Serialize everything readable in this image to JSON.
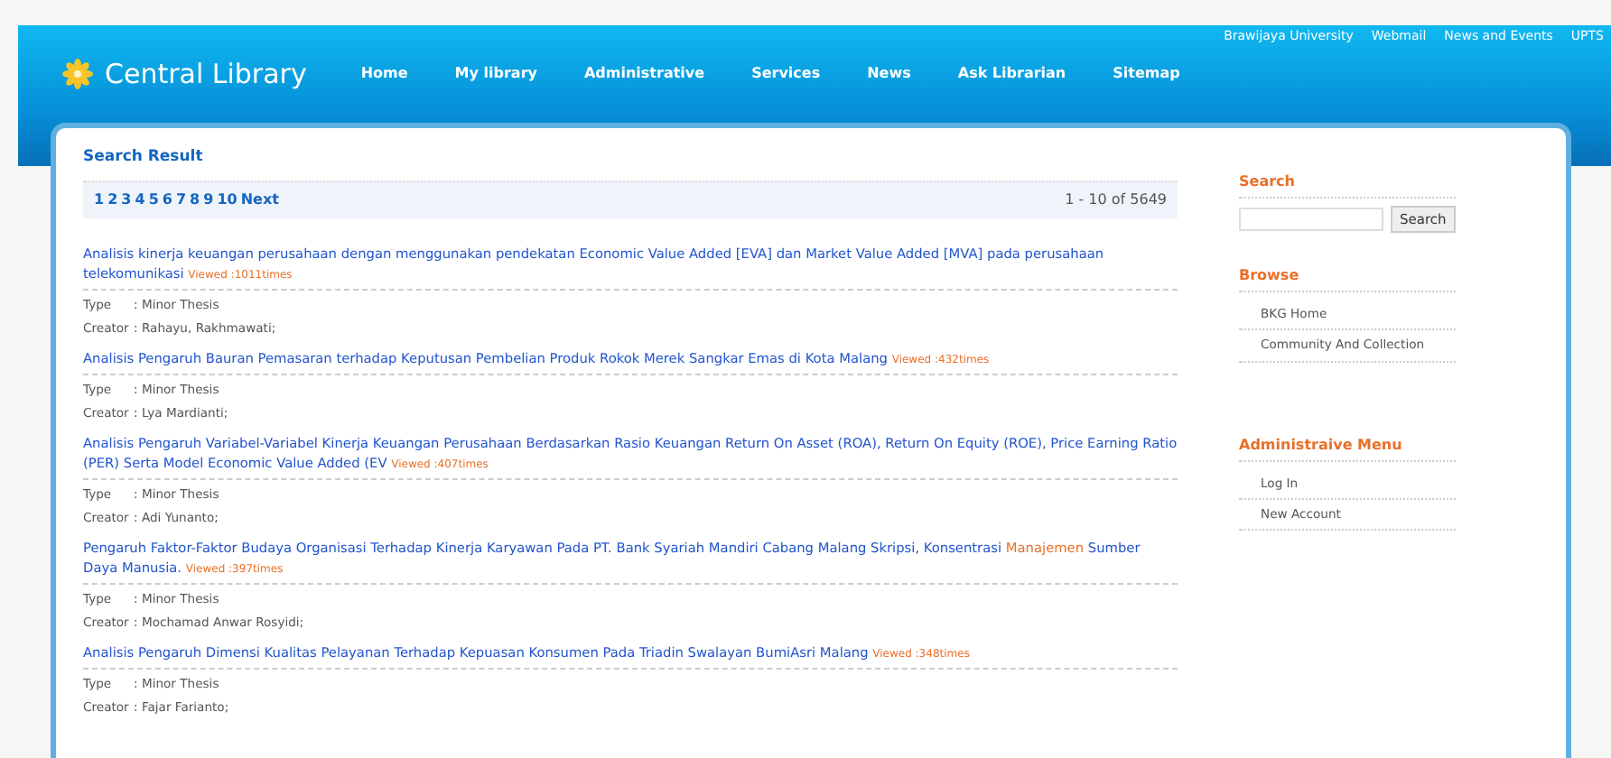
{
  "top_links": [
    "Brawijaya University",
    "Webmail",
    "News and Events",
    "UPTS"
  ],
  "logo": {
    "title": "Central Library"
  },
  "nav": [
    "Home",
    "My library",
    "Administrative",
    "Services",
    "News",
    "Ask Librarian",
    "Sitemap"
  ],
  "results": {
    "heading": "Search Result",
    "pages": [
      "1",
      "2",
      "3",
      "4",
      "5",
      "6",
      "7",
      "8",
      "9",
      "10",
      "Next"
    ],
    "range": "1 - 10 of 5649",
    "items": [
      {
        "title": [
          {
            "text": "Analisis kinerja keuangan perusahaan dengan menggunakan pendekatan Economic Value Added [EVA] dan Market Value Added [MVA] pada perusahaan telekomunikasi",
            "highlight": false
          }
        ],
        "views": "Viewed :1011times",
        "type_label": "Type",
        "type": ": Minor Thesis",
        "creator_label": "Creator",
        "creator": ": Rahayu, Rakhmawati;"
      },
      {
        "title": [
          {
            "text": "Analisis Pengaruh Bauran Pemasaran terhadap Keputusan Pembelian Produk Rokok Merek Sangkar Emas di Kota Malang",
            "highlight": false
          }
        ],
        "views": "Viewed :432times",
        "type_label": "Type",
        "type": ": Minor Thesis",
        "creator_label": "Creator",
        "creator": ": Lya Mardianti;"
      },
      {
        "title": [
          {
            "text": "Analisis Pengaruh Variabel-Variabel Kinerja Keuangan Perusahaan Berdasarkan Rasio Keuangan Return On Asset (ROA), Return On Equity (ROE), Price Earning Ratio (PER) Serta Model Economic Value Added (EV",
            "highlight": false
          }
        ],
        "views": "Viewed :407times",
        "type_label": "Type",
        "type": ": Minor Thesis",
        "creator_label": "Creator",
        "creator": ": Adi Yunanto;"
      },
      {
        "title": [
          {
            "text": "Pengaruh Faktor-Faktor Budaya Organisasi Terhadap Kinerja Karyawan Pada PT. Bank Syariah Mandiri Cabang Malang Skripsi, Konsentrasi ",
            "highlight": false
          },
          {
            "text": "Manajemen",
            "highlight": true
          },
          {
            "text": " Sumber Daya Manusia.",
            "highlight": false
          }
        ],
        "views": "Viewed :397times",
        "type_label": "Type",
        "type": ": Minor Thesis",
        "creator_label": "Creator",
        "creator": ": Mochamad Anwar Rosyidi;"
      },
      {
        "title": [
          {
            "text": "Analisis Pengaruh Dimensi Kualitas Pelayanan Terhadap Kepuasan Konsumen Pada Triadin Swalayan BumiAsri Malang",
            "highlight": false
          }
        ],
        "views": "Viewed :348times",
        "type_label": "Type",
        "type": ": Minor Thesis",
        "creator_label": "Creator",
        "creator": ": Fajar Farianto;"
      }
    ]
  },
  "sidebar": {
    "search_heading": "Search",
    "search_button": "Search",
    "sections": [
      {
        "heading": "Browse",
        "items": [
          "BKG Home",
          "Community And Collection"
        ]
      },
      {
        "heading": "Administraive Menu",
        "items": [
          "Log In",
          "New Account"
        ]
      }
    ]
  }
}
